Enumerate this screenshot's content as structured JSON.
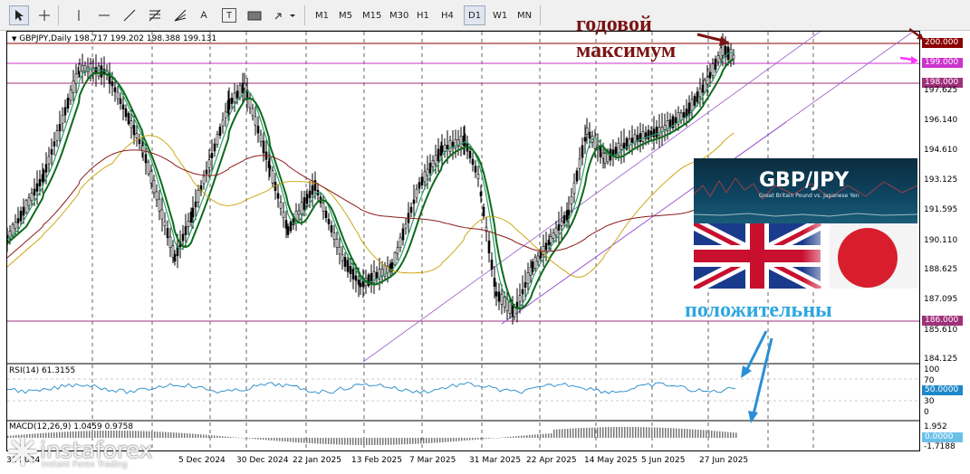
{
  "toolbar": {
    "timeframes": [
      "M1",
      "M5",
      "M15",
      "M30",
      "H1",
      "H4",
      "D1",
      "W1",
      "MN"
    ],
    "active_timeframe": "D1",
    "text_tool": "A",
    "label_tool": "T"
  },
  "chart": {
    "symbol_header": "GBPJPY,Daily  198.717 199.202 198.388 199.131",
    "rsi_header": "RSI(14) 61.3155",
    "macd_header": "MACD(12,26,9) 1.0459 0.9758",
    "price_labels": [
      "197.625",
      "196.140",
      "194.610",
      "193.125",
      "191.595",
      "190.110",
      "188.625",
      "187.095",
      "185.610",
      "184.125"
    ],
    "level_boxes": [
      {
        "value": "200.000",
        "color": "#8b0000"
      },
      {
        "value": "199.000",
        "color": "#cc33cc"
      },
      {
        "value": "198.000",
        "color": "#a0307a"
      },
      {
        "value": "186.000",
        "color": "#a0307a"
      }
    ],
    "rsi_labels": [
      "100",
      "70",
      "30",
      "0"
    ],
    "rsi_box": "50.0000",
    "macd_labels": [
      "1.952",
      "-1.7188"
    ],
    "macd_box": "0.0000",
    "dates": [
      "5 Dec 2024",
      "30 Dec 2024",
      "22 Jan 2025",
      "13 Feb 2025",
      "7 Mar 2025",
      "31 Mar 2025",
      "22 Apr 2025",
      "14 May 2025",
      "5 Jun 2025",
      "27 Jun 2025"
    ],
    "dates_partial": [
      "31",
      "2024"
    ]
  },
  "annotations": {
    "yearly_max": "годовой максимум",
    "positive": "положительны",
    "max_color": "#7a1414",
    "positive_color": "#2ea7e0"
  },
  "pair_card": {
    "title": "GBP/JPY",
    "subtitle": "Great Britain Pound vs. Japanese Yen"
  },
  "logo": {
    "name": "instaforex",
    "tagline": "Instant Forex Trading"
  }
}
